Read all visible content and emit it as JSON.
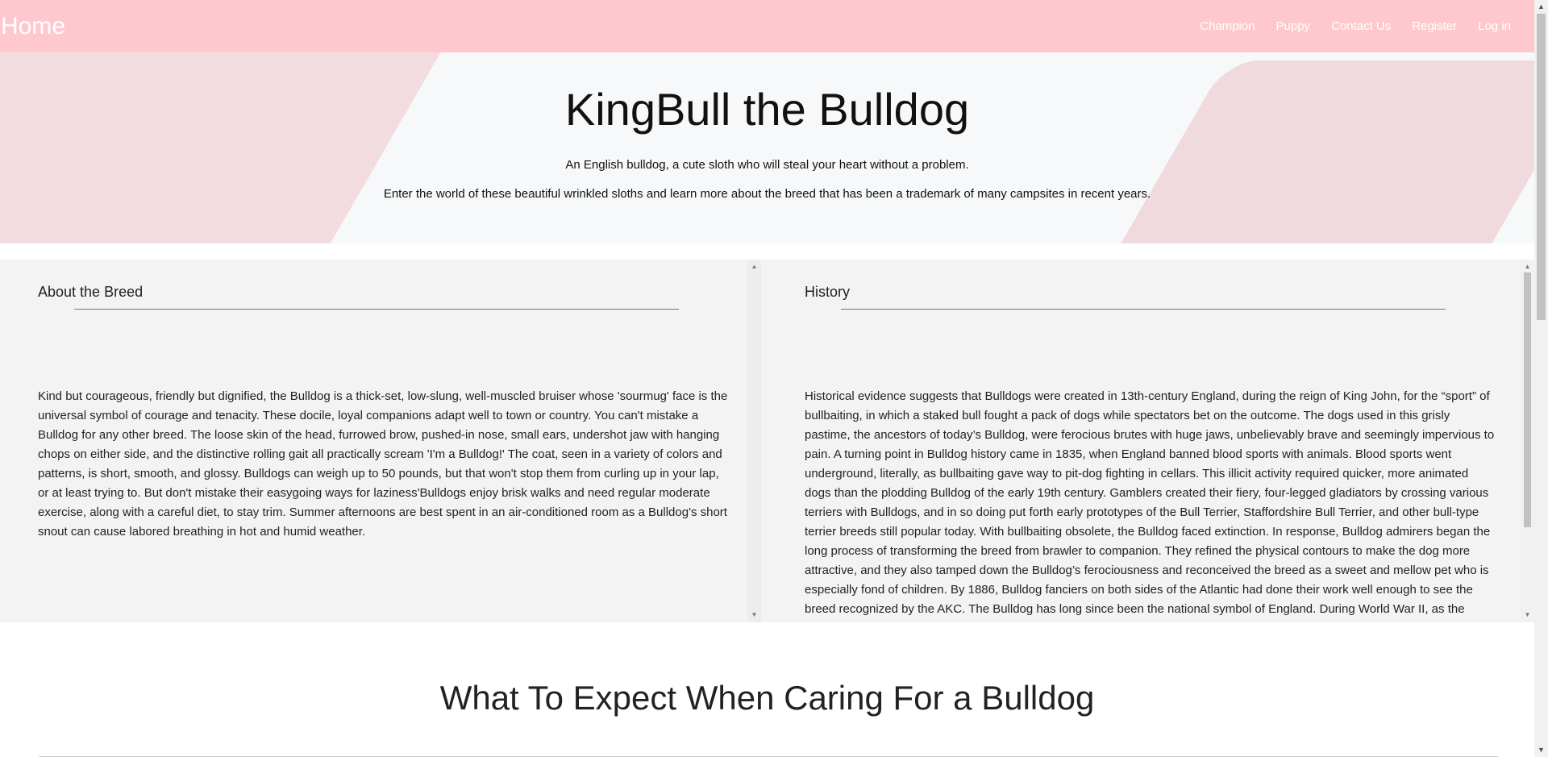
{
  "navbar": {
    "brand": "Home",
    "links": [
      "Champion",
      "Puppy",
      "Contact Us",
      "Register",
      "Log in"
    ]
  },
  "hero": {
    "title": "KingBull the Bulldog",
    "subtitle": "An English bulldog, a cute sloth who will steal your heart without a problem.",
    "subtitle2": "Enter the world of these beautiful wrinkled sloths and learn more about the breed that has been a trademark of many campsites in recent years."
  },
  "about": {
    "title": "About the Breed",
    "text": "Kind but courageous, friendly but dignified, the Bulldog is a thick-set, low-slung, well-muscled bruiser whose 'sourmug' face is the universal symbol of courage and tenacity. These docile, loyal companions adapt well to town or country. You can't mistake a Bulldog for any other breed. The loose skin of the head, furrowed brow, pushed-in nose, small ears, undershot jaw with hanging chops on either side, and the distinctive rolling gait all practically scream 'I'm a Bulldog!' The coat, seen in a variety of colors and patterns, is short, smooth, and glossy. Bulldogs can weigh up to 50 pounds, but that won't stop them from curling up in your lap, or at least trying to. But don't mistake their easygoing ways for laziness'Bulldogs enjoy brisk walks and need regular moderate exercise, along with a careful diet, to stay trim. Summer afternoons are best spent in an air-conditioned room as a Bulldog's short snout can cause labored breathing in hot and humid weather."
  },
  "history": {
    "title": "History",
    "text": "Historical evidence suggests that Bulldogs were created in 13th-century England, during the reign of King John, for the “sport” of bullbaiting, in which a staked bull fought a pack of dogs while spectators bet on the outcome. The dogs used in this grisly pastime, the ancestors of today’s Bulldog, were ferocious brutes with huge jaws, unbelievably brave and seemingly impervious to pain. A turning point in Bulldog history came in 1835, when England banned blood sports with animals. Blood sports went underground, literally, as bullbaiting gave way to pit-dog fighting in cellars. This illicit activity required quicker, more animated dogs than the plodding Bulldog of the early 19th century. Gamblers created their fiery, four-legged gladiators by crossing various terriers with Bulldogs, and in so doing put forth early prototypes of the Bull Terrier, Staffordshire Bull Terrier, and other bull-type terrier breeds still popular today. With bullbaiting obsolete, the Bulldog faced extinction. In response, Bulldog admirers began the long process of transforming the breed from brawler to companion. They refined the physical contours to make the dog more attractive, and they also tamped down the Bulldog’s ferociousness and reconceived the breed as a sweet and mellow pet who is especially fond of children. By 1886, Bulldog fanciers on both sides of the Atlantic had done their work well enough to see the breed recognized by the AKC. The Bulldog has long since been the national symbol of England. During World War II, as the symbol of the"
  },
  "care": {
    "title": "What To Expect When Caring For a Bulldog"
  },
  "icons": {
    "scroll_up": "▲",
    "scroll_down": "▼"
  },
  "colors": {
    "navbar": "#ffc8cf",
    "hero_bg": "#f7f8f9",
    "panel_bg": "#f3f3f3"
  }
}
